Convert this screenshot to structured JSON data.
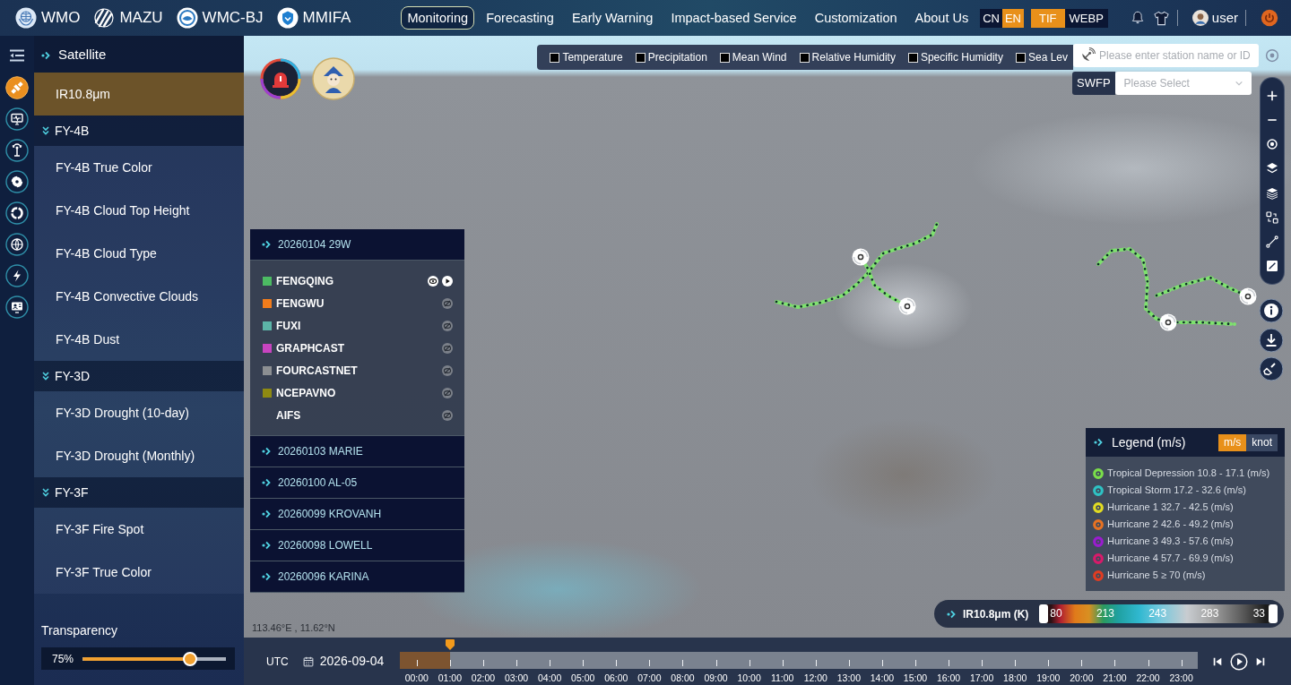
{
  "header": {
    "brands": [
      {
        "label": "WMO"
      },
      {
        "label": "MAZU"
      },
      {
        "label": "WMC-BJ"
      },
      {
        "label": "MMIFA"
      }
    ],
    "nav": [
      {
        "label": "Monitoring",
        "selected": true
      },
      {
        "label": "Forecasting",
        "selected": false
      },
      {
        "label": "Early Warning",
        "selected": false
      },
      {
        "label": "Impact-based Service",
        "selected": false
      },
      {
        "label": "Customization",
        "selected": false
      },
      {
        "label": "About Us",
        "selected": false
      }
    ],
    "languages": [
      {
        "label": "CN",
        "selected": false
      },
      {
        "label": "EN",
        "selected": true
      }
    ],
    "formats": [
      {
        "label": "TIF",
        "selected": true
      },
      {
        "label": "WEBP",
        "selected": false
      }
    ],
    "user": "user"
  },
  "tool_rail": [
    {
      "selected": true
    },
    {
      "selected": false
    },
    {
      "selected": false
    },
    {
      "selected": false
    },
    {
      "selected": false
    },
    {
      "selected": false
    },
    {
      "selected": false
    },
    {
      "selected": false
    }
  ],
  "sidebar": {
    "title": "Satellite",
    "items": [
      {
        "label": "IR10.8μm",
        "selected": true
      }
    ],
    "groups": [
      {
        "title": "FY-4B",
        "expanded": true,
        "items": [
          {
            "label": "FY-4B True Color",
            "selected": false
          },
          {
            "label": "FY-4B Cloud Top Height",
            "selected": false
          },
          {
            "label": "FY-4B Cloud Type",
            "selected": false
          },
          {
            "label": "FY-4B Convective Clouds",
            "selected": false
          },
          {
            "label": "FY-4B Dust",
            "selected": false
          }
        ]
      },
      {
        "title": "FY-3D",
        "expanded": true,
        "items": [
          {
            "label": "FY-3D Drought (10-day)",
            "selected": false
          },
          {
            "label": "FY-3D Drought (Monthly)",
            "selected": false
          }
        ]
      },
      {
        "title": "FY-3F",
        "expanded": true,
        "items": [
          {
            "label": "FY-3F Fire Spot",
            "selected": false
          },
          {
            "label": "FY-3F True Color",
            "selected": false
          }
        ]
      }
    ],
    "transparency": {
      "label": "Transparency",
      "reading": "75%",
      "level": 0.75
    }
  },
  "map": {
    "layers": [
      {
        "label": "Temperature",
        "checked": false
      },
      {
        "label": "Precipitation",
        "checked": false
      },
      {
        "label": "Mean Wind",
        "checked": false
      },
      {
        "label": "Relative Humidity",
        "checked": false
      },
      {
        "label": "Specific Humidity",
        "checked": false
      },
      {
        "label": "Sea Lev",
        "checked": false
      }
    ],
    "search": {
      "placeholder": "Please enter station name or ID"
    },
    "swfp": {
      "label": "SWFP",
      "placeholder": "Please Select"
    },
    "typhoons": [
      {
        "label": "20260104 29W",
        "models": [
          {
            "name": "FENGQING",
            "color": "#4cbb63",
            "visible": true
          },
          {
            "name": "FENGWU",
            "color": "#f07c1c",
            "visible": false
          },
          {
            "name": "FUXI",
            "color": "#5cb5a8",
            "visible": false
          },
          {
            "name": "GRAPHCAST",
            "color": "#c844c0",
            "visible": false
          },
          {
            "name": "FOURCASTNET",
            "color": "#8c8f92",
            "visible": false
          },
          {
            "name": "NCEPAVNO",
            "color": "#8e8a12",
            "visible": false
          },
          {
            "name": "AIFS",
            "visible": false
          }
        ]
      },
      {
        "label": "20260103 MARIE"
      },
      {
        "label": "20260100 AL-05"
      },
      {
        "label": "20260099 KROVANH"
      },
      {
        "label": "20260098 LOWELL"
      },
      {
        "label": "20260096 KARINA"
      }
    ],
    "legend": {
      "title": "Legend (m/s)",
      "units": [
        {
          "label": "m/s",
          "selected": true
        },
        {
          "label": "knot",
          "selected": false
        }
      ],
      "items": [
        {
          "label": "Tropical Depression 10.8 - 17.1 (m/s)",
          "color": "#7ade4a"
        },
        {
          "label": "Tropical Storm 17.2 - 32.6 (m/s)",
          "color": "#2ec2c4"
        },
        {
          "label": "Hurricane 1 32.7 - 42.5 (m/s)",
          "color": "#e2dc22"
        },
        {
          "label": "Hurricane 2 42.6 - 49.2 (m/s)",
          "color": "#e87222"
        },
        {
          "label": "Hurricane 3 49.3 - 57.6 (m/s)",
          "color": "#9a1ccf"
        },
        {
          "label": "Hurricane 4 57.7 - 69.9 (m/s)",
          "color": "#d81a6a"
        },
        {
          "label": "Hurricane 5 ≥ 70 (m/s)",
          "color": "#e03c22"
        }
      ]
    },
    "color_scale": {
      "label": "IR10.8μm (K)",
      "ticks": [
        "80",
        "213",
        "243",
        "283",
        "33"
      ]
    },
    "coordinates": "113.46°E , 11.62°N"
  },
  "timeline": {
    "zone": "UTC",
    "date": "2026-09-04",
    "hours": [
      {
        "label": "00:00",
        "selected": false
      },
      {
        "label": "01:00",
        "selected": true
      },
      {
        "label": "02:00",
        "selected": false
      },
      {
        "label": "03:00",
        "selected": false
      },
      {
        "label": "04:00",
        "selected": false
      },
      {
        "label": "05:00",
        "selected": false
      },
      {
        "label": "06:00",
        "selected": false
      },
      {
        "label": "07:00",
        "selected": false
      },
      {
        "label": "08:00",
        "selected": false
      },
      {
        "label": "09:00",
        "selected": false
      },
      {
        "label": "10:00",
        "selected": false
      },
      {
        "label": "11:00",
        "selected": false
      },
      {
        "label": "12:00",
        "selected": false
      },
      {
        "label": "13:00",
        "selected": false
      },
      {
        "label": "14:00",
        "selected": false
      },
      {
        "label": "15:00",
        "selected": false
      },
      {
        "label": "16:00",
        "selected": false
      },
      {
        "label": "17:00",
        "selected": false
      },
      {
        "label": "18:00",
        "selected": false
      },
      {
        "label": "19:00",
        "selected": false
      },
      {
        "label": "20:00",
        "selected": false
      },
      {
        "label": "21:00",
        "selected": false
      },
      {
        "label": "22:00",
        "selected": false
      },
      {
        "label": "23:00",
        "selected": false
      }
    ]
  }
}
